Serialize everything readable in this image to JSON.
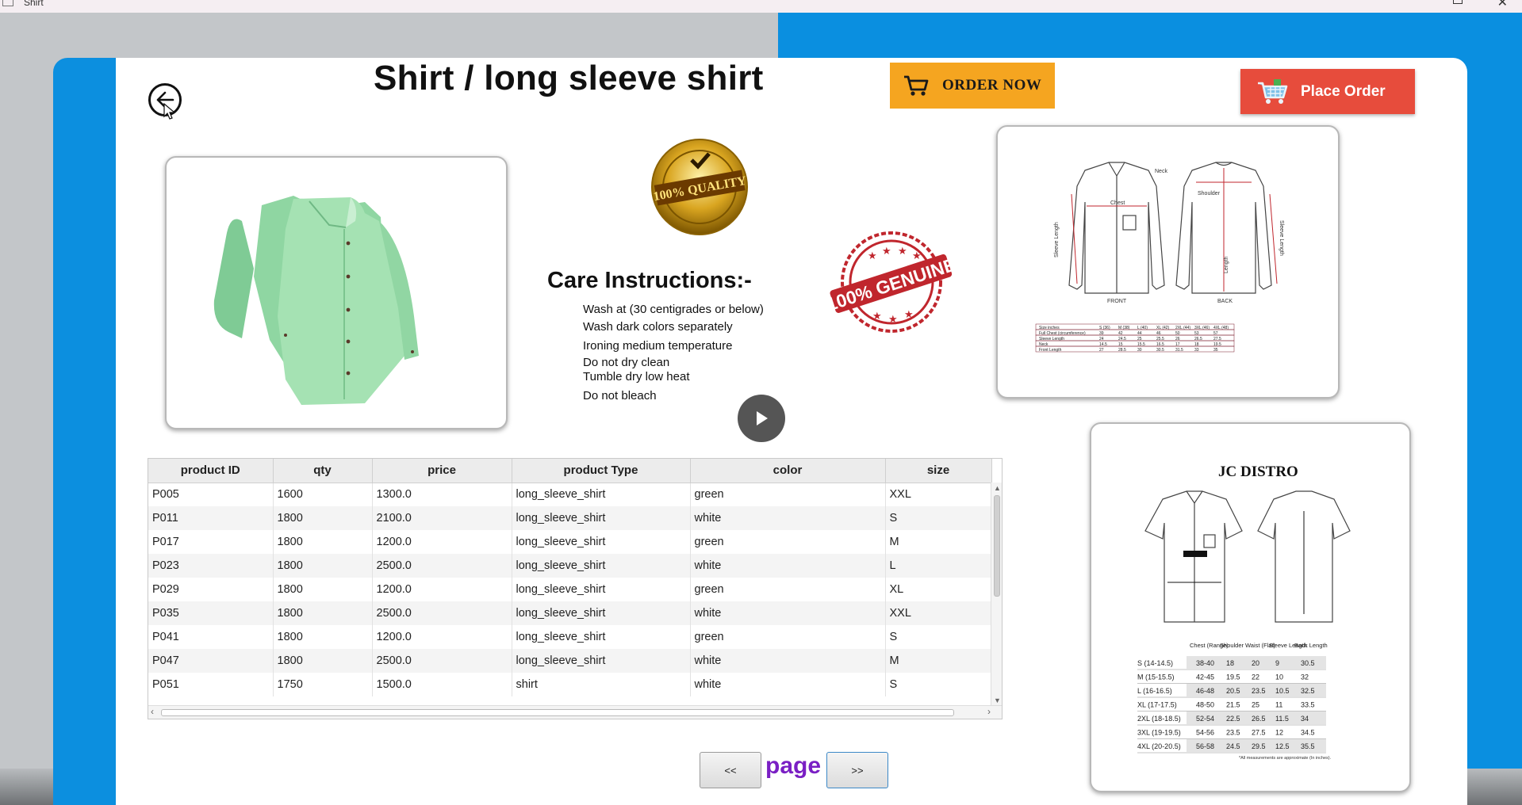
{
  "window": {
    "title": "Shirt"
  },
  "page": {
    "title": "Shirt  /  long sleeve shirt"
  },
  "buttons": {
    "order_now": "ORDER NOW",
    "place_order": "Place Order"
  },
  "badges": {
    "quality": "100% QUALITY",
    "genuine": "100% GENUINE"
  },
  "care": {
    "title": "Care Instructions:-",
    "items": [
      "Wash at (30 centigrades or below)",
      "Wash dark colors separately",
      "Ironing medium temperature",
      "Do not dry clean",
      "Tumble dry low heat",
      " Do not bleach"
    ]
  },
  "size_chart_1": {
    "labels": {
      "neck": "Neck",
      "chest": "Chest",
      "shoulder": "Shoulder",
      "sleeve_length": "Sleeve Length",
      "length": "Length",
      "front": "FRONT",
      "back": "BACK"
    },
    "header": [
      "Size inches",
      "S (36)",
      "M (38)",
      "L (40)",
      "XL (42)",
      "2XL (44)",
      "3XL (46)",
      "4XL (48)"
    ],
    "rows": [
      [
        "Full Chest (circumference)",
        "39",
        "42",
        "44",
        "46",
        "50",
        "53",
        "57"
      ],
      [
        "Sleeve Length",
        "24",
        "24.5",
        "25",
        "25.5",
        "26",
        "26.5",
        "27.5"
      ],
      [
        "Neck",
        "14.5",
        "15",
        "15.5",
        "16.5",
        "17",
        "18",
        "19.5"
      ],
      [
        "Front Length",
        "27",
        "28.5",
        "30",
        "30.5",
        "31.5",
        "33",
        "35"
      ]
    ]
  },
  "size_chart_2": {
    "brand": "JC DISTRO",
    "header": [
      "",
      "Chest (Range)",
      "Shoulder",
      "Waist (Flat)",
      "Sleeve Length",
      "Back Length"
    ],
    "rows": [
      [
        "S (14-14.5)",
        "38-40",
        "18",
        "20",
        "9",
        "30.5"
      ],
      [
        "M (15-15.5)",
        "42-45",
        "19.5",
        "22",
        "10",
        "32"
      ],
      [
        "L (16-16.5)",
        "46-48",
        "20.5",
        "23.5",
        "10.5",
        "32.5"
      ],
      [
        "XL (17-17.5)",
        "48-50",
        "21.5",
        "25",
        "11",
        "33.5"
      ],
      [
        "2XL (18-18.5)",
        "52-54",
        "22.5",
        "26.5",
        "11.5",
        "34"
      ],
      [
        "3XL (19-19.5)",
        "54-56",
        "23.5",
        "27.5",
        "12",
        "34.5"
      ],
      [
        "4XL (20-20.5)",
        "56-58",
        "24.5",
        "29.5",
        "12.5",
        "35.5"
      ]
    ],
    "note": "*All measurements are approximate (In inches)."
  },
  "table": {
    "columns": [
      "product ID",
      "qty",
      "price",
      "product Type",
      "color",
      "size"
    ],
    "rows": [
      [
        "P005",
        "1600",
        "1300.0",
        "long_sleeve_shirt",
        "green",
        "XXL"
      ],
      [
        "P011",
        "1800",
        "2100.0",
        "long_sleeve_shirt",
        "white",
        "S"
      ],
      [
        "P017",
        "1800",
        "1200.0",
        "long_sleeve_shirt",
        "green",
        "M"
      ],
      [
        "P023",
        "1800",
        "2500.0",
        "long_sleeve_shirt",
        "white",
        "L"
      ],
      [
        "P029",
        "1800",
        "1200.0",
        "long_sleeve_shirt",
        "green",
        "XL"
      ],
      [
        "P035",
        "1800",
        "2500.0",
        "long_sleeve_shirt",
        "white",
        "XXL"
      ],
      [
        "P041",
        "1800",
        "1200.0",
        "long_sleeve_shirt",
        "green",
        "S"
      ],
      [
        "P047",
        "1800",
        "2500.0",
        "long_sleeve_shirt",
        "white",
        "M"
      ],
      [
        "P051",
        "1750",
        "1500.0",
        "shirt",
        "white",
        "S"
      ]
    ]
  },
  "pagination": {
    "prev": "<<",
    "label": "page",
    "next": ">>"
  },
  "colors": {
    "accent_blue": "#0c8fdf",
    "order_now": "#f5a520",
    "place_order": "#e74c3c",
    "page_label": "#7a1fc4"
  }
}
